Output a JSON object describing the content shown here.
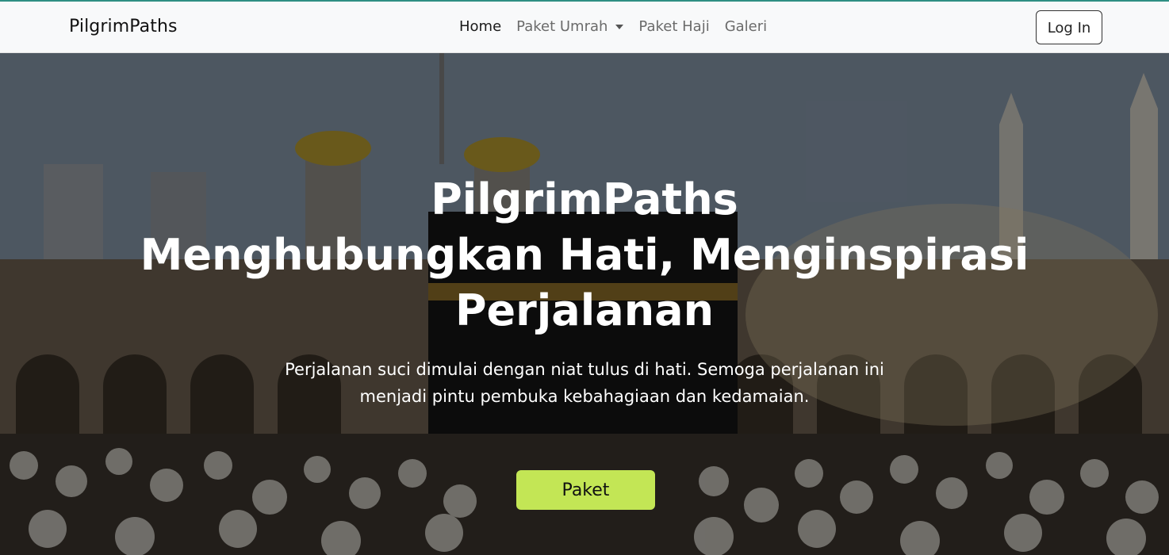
{
  "navbar": {
    "brand": "PilgrimPaths",
    "links": [
      {
        "label": "Home",
        "active": true
      },
      {
        "label": "Paket Umrah",
        "dropdown": true
      },
      {
        "label": "Paket Haji"
      },
      {
        "label": "Galeri"
      }
    ],
    "login_label": "Log In"
  },
  "hero": {
    "title_line1": "PilgrimPaths",
    "title_line2": "Menghubungkan Hati, Menginspirasi",
    "title_line3": "Perjalanan",
    "subtitle_line1": "Perjalanan suci dimulai dengan niat tulus di hati. Semoga perjalanan ini",
    "subtitle_line2": "menjadi pintu pembuka kebahagiaan dan kedamaian.",
    "cta_label": "Paket"
  },
  "colors": {
    "accent_top_border": "#2f8f83",
    "cta_background": "#c3e655",
    "navbar_background": "#f8f9fa"
  }
}
